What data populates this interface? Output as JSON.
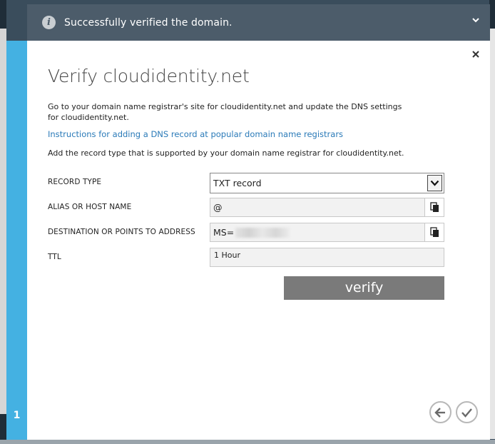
{
  "notification": {
    "message": "Successfully verified the domain.",
    "icon": "info-icon",
    "expand_icon": "chevron-down-icon"
  },
  "dialog": {
    "title": "Verify cloudidentity.net",
    "description": "Go to your domain name registrar's site for cloudidentity.net and update the DNS settings for cloudidentity.net.",
    "instructions_link": "Instructions for adding a DNS record at popular domain name registrars",
    "record_note": "Add the record type that is supported by your domain name registrar for cloudidentity.net.",
    "step": "1",
    "close_icon": "close-icon"
  },
  "form": {
    "record_type_label": "RECORD TYPE",
    "record_type_value": "TXT record",
    "alias_label": "ALIAS OR HOST NAME",
    "alias_value": "@",
    "destination_label": "DESTINATION OR POINTS TO ADDRESS",
    "destination_value": "MS=",
    "ttl_label": "TTL",
    "ttl_value": "1 Hour",
    "verify_label": "verify"
  },
  "colors": {
    "step_strip": "#44b1e2",
    "notification_bg": "#4c5c6a",
    "verify_button": "#7a7a7a",
    "link": "#2a7ab8"
  }
}
